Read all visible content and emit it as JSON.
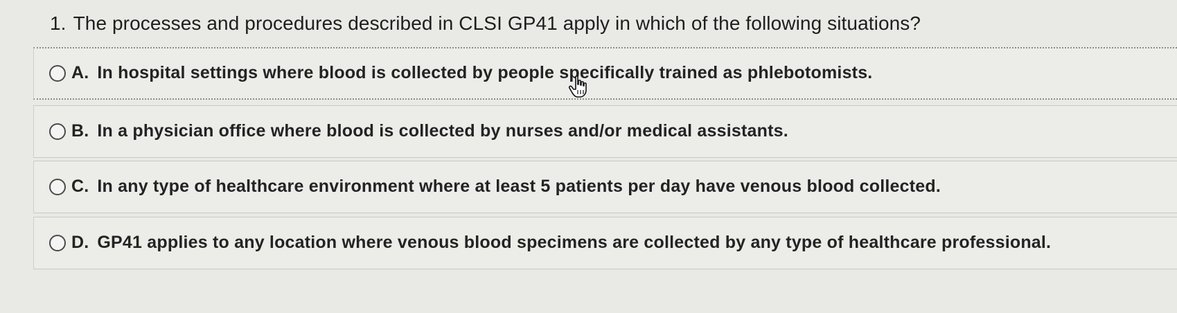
{
  "question": {
    "number": "1.",
    "text": "The processes and procedures described in CLSI GP41 apply in which of the following situations?"
  },
  "options": [
    {
      "letter": "A.",
      "text": "In hospital settings where blood is collected by people specifically trained as phlebotomists."
    },
    {
      "letter": "B.",
      "text": "In a physician office where blood is collected by nurses and/or medical assistants."
    },
    {
      "letter": "C.",
      "text": "In any type of healthcare environment where at least 5 patients per day have venous blood collected."
    },
    {
      "letter": "D.",
      "text": "GP41 applies to any location where venous blood specimens are collected by any type of healthcare professional."
    }
  ],
  "cursor": {
    "icon": "hand-pointer-icon"
  }
}
